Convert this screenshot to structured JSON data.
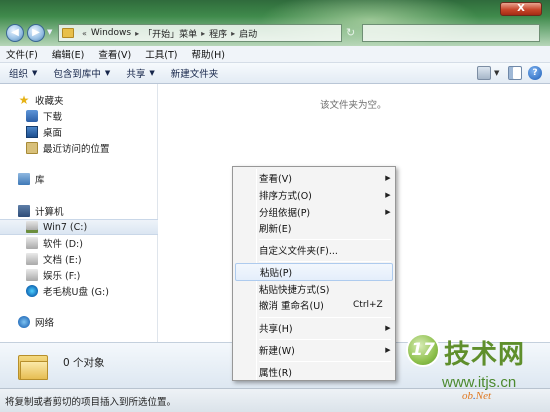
{
  "address": {
    "crumbs": [
      "Windows",
      "「开始」菜单",
      "程序",
      "启动"
    ]
  },
  "window_controls": {
    "close": "X"
  },
  "menubar": [
    "文件(F)",
    "编辑(E)",
    "查看(V)",
    "工具(T)",
    "帮助(H)"
  ],
  "toolbar": {
    "organize": "组织",
    "include_library": "包含到库中",
    "share": "共享",
    "new_folder": "新建文件夹"
  },
  "navpane": {
    "favorites": {
      "label": "收藏夹",
      "items": [
        "下载",
        "桌面",
        "最近访问的位置"
      ]
    },
    "libraries": "库",
    "computer": {
      "label": "计算机",
      "drives": [
        "Win7 (C:)",
        "软件 (D:)",
        "文档 (E:)",
        "娱乐 (F:)",
        "老毛桃U盘 (G:)"
      ]
    },
    "network": "网络"
  },
  "content": {
    "empty_message": "该文件夹为空。"
  },
  "details": {
    "count": "0 个对象"
  },
  "statusbar": {
    "text": "将复制或者剪切的项目插入到所选位置。"
  },
  "context_menu": {
    "items": [
      {
        "label": "查看(V)",
        "submenu": true
      },
      {
        "label": "排序方式(O)",
        "submenu": true
      },
      {
        "label": "分组依据(P)",
        "submenu": true
      },
      {
        "label": "刷新(E)",
        "submenu": false
      },
      {
        "label": "自定义文件夹(F)...",
        "submenu": false
      },
      {
        "label": "粘贴(P)",
        "submenu": false,
        "highlighted": true
      },
      {
        "label": "粘贴快捷方式(S)",
        "submenu": false
      },
      {
        "label": "撤消 重命名(U)",
        "submenu": false,
        "shortcut": "Ctrl+Z"
      },
      {
        "label": "共享(H)",
        "submenu": true
      },
      {
        "label": "新建(W)",
        "submenu": true
      },
      {
        "label": "属性(R)",
        "submenu": false
      }
    ]
  },
  "watermark": {
    "badge": "17",
    "title": "技术网",
    "url": "www.itjs.cn",
    "suffix_prefix": "ob",
    "suffix_dot": ".",
    "suffix": "Net"
  },
  "colors": {
    "title_green": "#3f8a4b",
    "menu_highlight": "#aecbee",
    "watermark_green": "#5f8f2c"
  }
}
